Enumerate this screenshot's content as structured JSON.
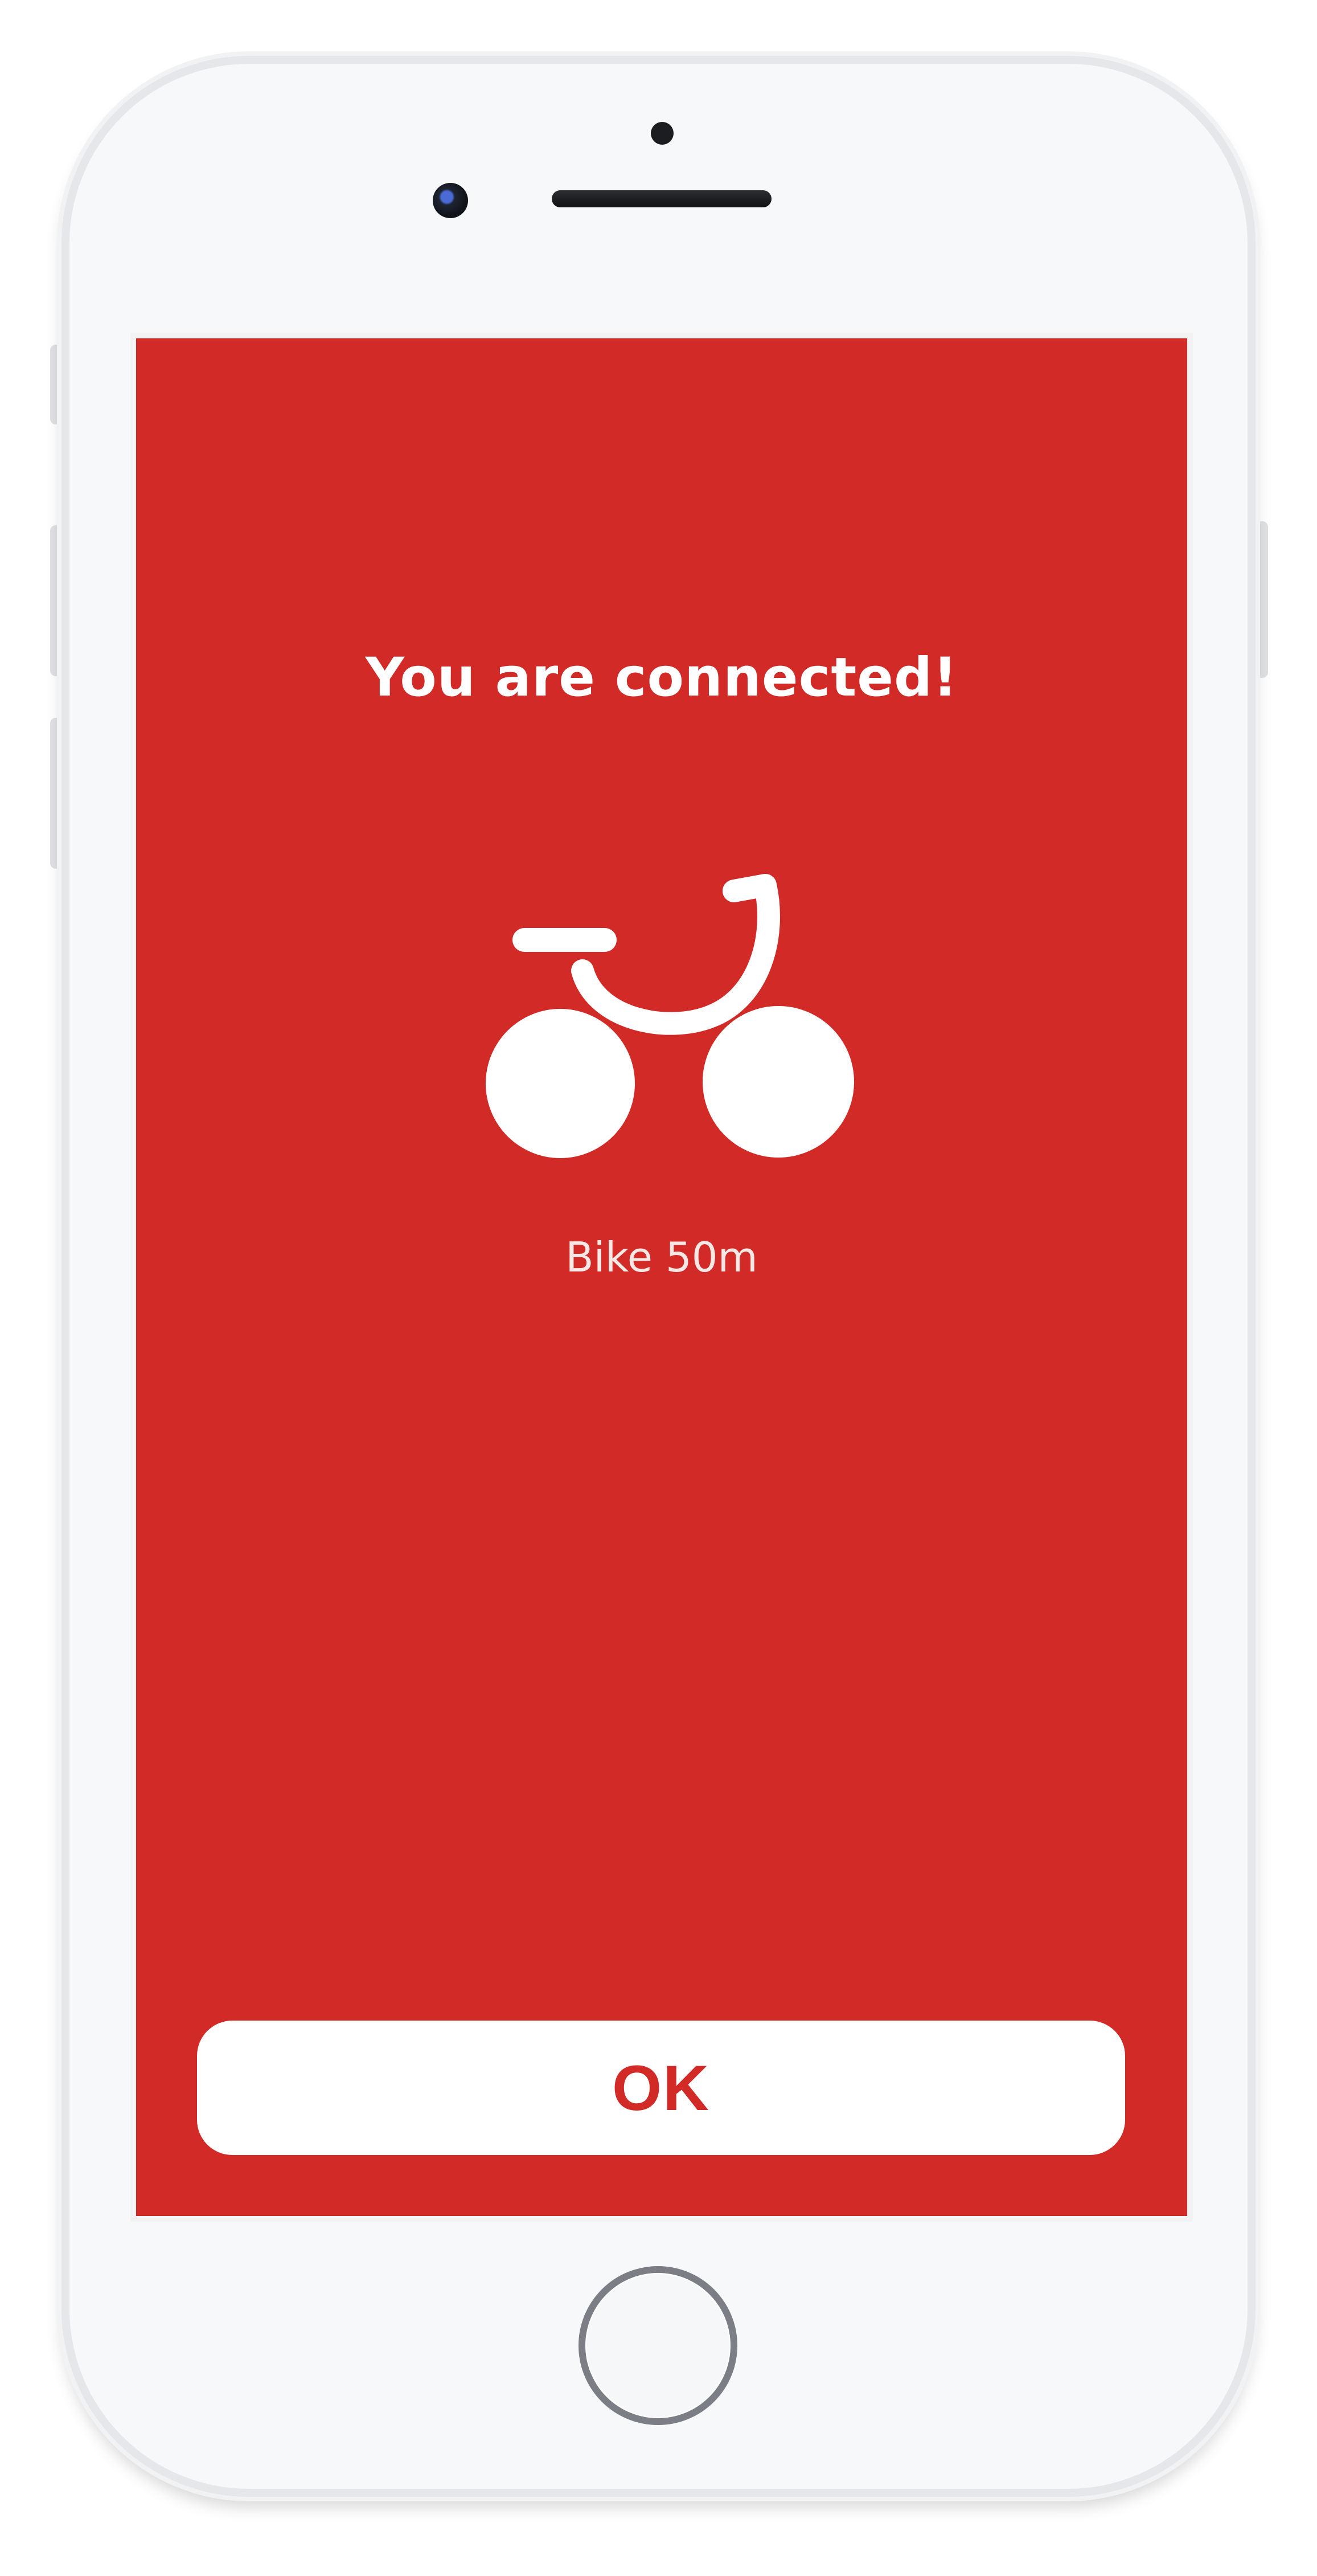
{
  "connection_screen": {
    "title": "You are connected!",
    "device_name": "Bike 50m",
    "ok_label": "OK",
    "icon": "bike-icon"
  },
  "colors": {
    "accent": "#d12a27",
    "text_on_accent": "#ffffff",
    "button_bg": "#ffffff"
  }
}
